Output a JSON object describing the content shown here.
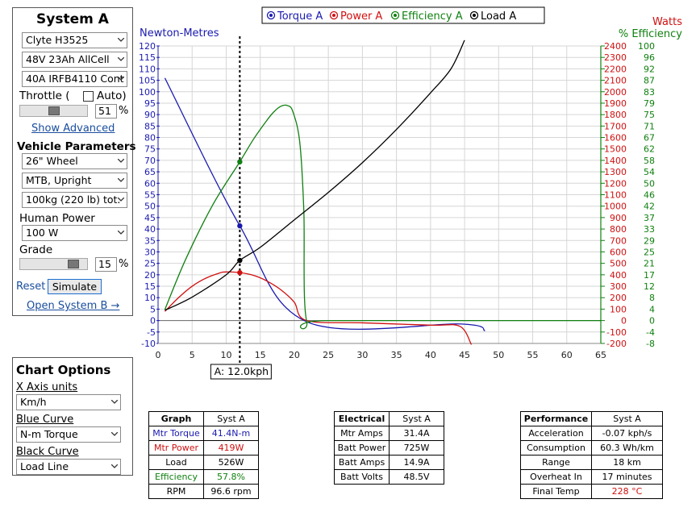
{
  "system_panel": {
    "title": "System A",
    "motor": "Clyte H3525",
    "battery": "48V 23Ah AllCell",
    "controller": "40A IRFB4110 Cont",
    "throttle_label": "Throttle (",
    "auto_label": "Auto)",
    "throttle_value": "51",
    "throttle_fraction": 0.51,
    "pct_sign": "%",
    "show_advanced": "Show Advanced",
    "vehicle_params_title": "Vehicle Parameters",
    "wheel": "26\"  Wheel",
    "frame": "MTB, Upright",
    "weight": "100kg (220 lb) tot.",
    "human_power_label": "Human Power",
    "human_power": "100 W",
    "grade_label": "Grade",
    "grade_value": "15",
    "grade_fraction": 0.85,
    "reset": "Reset",
    "simulate": "Simulate",
    "open_system_b": "Open System B →"
  },
  "chart_options": {
    "title": "Chart Options",
    "x_axis_label": "X Axis units",
    "x_axis_value": "Km/h",
    "blue_label": "Blue Curve",
    "blue_value": "N-m Torque",
    "black_label": "Black Curve",
    "black_value": "Load Line"
  },
  "chart_data": {
    "type": "line",
    "legend": [
      "Torque A",
      "Power A",
      "Efficiency A",
      "Load A"
    ],
    "legend_position": "top",
    "left_axis_label": "Newton-Metres",
    "right_axis_label_1": "Watts",
    "right_axis_label_2": "% Efficiency",
    "xlim": [
      0,
      65
    ],
    "x_ticks": [
      0,
      5,
      10,
      15,
      20,
      25,
      30,
      35,
      40,
      45,
      50,
      55,
      60,
      65
    ],
    "ylim_left": [
      -10,
      120
    ],
    "y_ticks_left": [
      -10,
      -5,
      0,
      5,
      10,
      15,
      20,
      25,
      30,
      35,
      40,
      45,
      50,
      55,
      60,
      65,
      70,
      75,
      80,
      85,
      90,
      95,
      100,
      105,
      110,
      115,
      120
    ],
    "y_ticks_watts": [
      -200,
      -100,
      0,
      100,
      200,
      300,
      400,
      500,
      600,
      700,
      800,
      900,
      1000,
      1100,
      1200,
      1300,
      1400,
      1500,
      1600,
      1700,
      1800,
      1900,
      2000,
      2100,
      2200,
      2300,
      2400
    ],
    "y_ticks_eff": [
      -8,
      -4,
      0,
      4,
      8,
      12,
      17,
      21,
      25,
      29,
      33,
      37,
      42,
      46,
      50,
      54,
      58,
      62,
      67,
      71,
      75,
      79,
      83,
      87,
      92,
      96,
      100
    ],
    "grid": true,
    "cursor_x": 12.0,
    "cursor_label": "A: 12.0kph",
    "series": [
      {
        "name": "Torque A",
        "color": "#1a1ab0",
        "unit": "Nm",
        "x": [
          1,
          12,
          21.8,
          44.5,
          48
        ],
        "y": [
          106,
          41.4,
          -0.5,
          -1.5,
          -4.5
        ]
      },
      {
        "name": "Power A",
        "color": "#d01010",
        "unit": "W",
        "x": [
          1,
          3,
          5,
          7,
          9,
          10,
          12,
          14,
          16,
          18,
          20,
          21.8,
          30,
          40,
          44.3,
          46
        ],
        "y": [
          80,
          200,
          300,
          370,
          415,
          425,
          419,
          395,
          345,
          270,
          160,
          0,
          -20,
          -40,
          -50,
          -210
        ]
      },
      {
        "name": "Efficiency A",
        "color": "#108010",
        "unit": "%",
        "x": [
          1,
          4,
          8,
          12,
          14,
          16,
          17,
          18,
          19,
          19.8,
          20.8,
          21.4,
          21.8,
          25,
          65
        ],
        "y": [
          4,
          22,
          42,
          57.8,
          66,
          73,
          76,
          78,
          78.3,
          76,
          65,
          40,
          0,
          0,
          0
        ]
      },
      {
        "name": "Load A",
        "color": "#000000",
        "unit": "W",
        "x": [
          1,
          5,
          10,
          12,
          15,
          20,
          25,
          30,
          35,
          40,
          43,
          45
        ],
        "y": [
          90,
          205,
          400,
          526,
          640,
          880,
          1120,
          1380,
          1670,
          1990,
          2200,
          2450
        ]
      }
    ],
    "cursor_points": [
      {
        "series": "Torque A",
        "y": 41.4
      },
      {
        "series": "Power A",
        "y": 419
      },
      {
        "series": "Efficiency A",
        "y": 57.8
      },
      {
        "series": "Load A",
        "y": 526
      }
    ]
  },
  "tables": {
    "graph": {
      "header": [
        "Graph",
        "Syst A"
      ],
      "rows": [
        [
          "Mtr Torque",
          "41.4N-m"
        ],
        [
          "Mtr Power",
          "419W"
        ],
        [
          "Load",
          "526W"
        ],
        [
          "Efficiency",
          "57.8%"
        ],
        [
          "RPM",
          "96.6 rpm"
        ]
      ]
    },
    "electrical": {
      "header": [
        "Electrical",
        "Syst A"
      ],
      "rows": [
        [
          "Mtr Amps",
          "31.4A"
        ],
        [
          "Batt Power",
          "725W"
        ],
        [
          "Batt Amps",
          "14.9A"
        ],
        [
          "Batt Volts",
          "48.5V"
        ]
      ]
    },
    "performance": {
      "header": [
        "Performance",
        "Syst A"
      ],
      "rows": [
        [
          "Acceleration",
          "-0.07 kph/s"
        ],
        [
          "Consumption",
          "60.3 Wh/km"
        ],
        [
          "Range",
          "18 km"
        ],
        [
          "Overheat In",
          "17 minutes"
        ],
        [
          "Final Temp",
          "228 °C"
        ]
      ]
    }
  }
}
